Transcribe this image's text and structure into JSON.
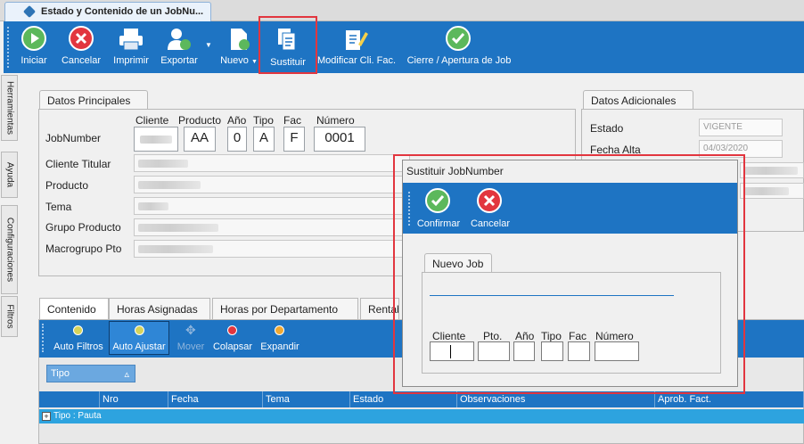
{
  "window": {
    "tab_title": "Estado y Contenido de un JobNu..."
  },
  "toolbar": {
    "buttons": {
      "iniciar": "Iniciar",
      "cancelar": "Cancelar",
      "imprimir": "Imprimir",
      "exportar": "Exportar",
      "nuevo": "Nuevo",
      "sustituir": "Sustituir",
      "modificar": "Modificar Cli. Fac.",
      "cierre": "Cierre / Apertura de Job"
    }
  },
  "side_tabs": [
    "Herramientas",
    "Ayuda",
    "Configuraciones",
    "Filtros"
  ],
  "datos_principales": {
    "title": "Datos Principales",
    "col_headers": {
      "cliente": "Cliente",
      "producto": "Producto",
      "anio": "Año",
      "tipo": "Tipo",
      "fac": "Fac",
      "numero": "Número"
    },
    "jobnumber_label": "JobNumber",
    "jobnumber": {
      "cliente": "",
      "producto": "AA",
      "anio": "0",
      "tipo": "A",
      "fac": "F",
      "numero": "0001"
    },
    "labels": {
      "cliente_titular": "Cliente Titular",
      "producto": "Producto",
      "tema": "Tema",
      "grupo_producto": "Grupo Producto",
      "macrogrupo": "Macrogrupo Pto"
    }
  },
  "datos_adicionales": {
    "title": "Datos Adicionales",
    "estado_label": "Estado",
    "estado_value": "VIGENTE",
    "fecha_alta_label": "Fecha Alta",
    "fecha_alta_value": "04/03/2020"
  },
  "bottom_tabs": [
    "Contenido",
    "Horas Asignadas",
    "Horas por Departamento",
    "Rentab"
  ],
  "grid_toolbar": {
    "auto_filtros": "Auto Filtros",
    "auto_ajustar": "Auto Ajustar",
    "mover": "Mover",
    "colapsar": "Colapsar",
    "expandir": "Expandir"
  },
  "grid": {
    "group_by": "Tipo",
    "columns": [
      "Nro",
      "Fecha",
      "Tema",
      "Estado",
      "Observaciones",
      "Aprob. Fact."
    ],
    "group_row": "Tipo : Pauta"
  },
  "dialog": {
    "title": "Sustituir JobNumber",
    "confirmar": "Confirmar",
    "cancelar": "Cancelar",
    "group_title": "Nuevo Job",
    "field_labels": {
      "cliente": "Cliente",
      "pto": "Pto.",
      "anio": "Año",
      "tipo": "Tipo",
      "fac": "Fac",
      "numero": "Número"
    }
  },
  "colors": {
    "toolbar_blue": "#1e74c3",
    "highlight_red": "#e2363f",
    "green": "#5cb85c",
    "red": "#e2363f"
  }
}
